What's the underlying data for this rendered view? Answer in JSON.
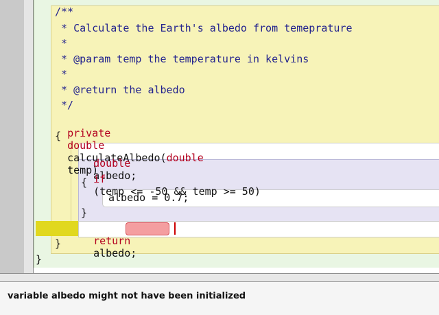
{
  "editor": {
    "comment_lines": [
      "/**",
      " * Calculate the Earth's albedo from temeprature",
      " *",
      " * @param temp the temperature in kelvins",
      " *",
      " * @return the albedo",
      " */"
    ],
    "method_signature": {
      "modifier": "private",
      "return_type": "double",
      "name": "calculateAlbedo(",
      "param_type": "double",
      "param_name": "temp)"
    },
    "open_brace": "{",
    "declaration": {
      "type": "double",
      "name": "albedo;"
    },
    "if_line": {
      "keyword": "if",
      "condition": "(temp <= -50 && temp >= 50)"
    },
    "if_open_brace": "{",
    "assignment": "albedo = 0.7;",
    "if_close_brace": "}",
    "return_line": {
      "keyword": "return",
      "variable": "albedo",
      "terminator": ";"
    },
    "method_close_brace": "}",
    "class_close_brace": "}"
  },
  "status": {
    "message": "variable albedo might not have been initialized"
  },
  "colors": {
    "comment": "#23238e",
    "keyword": "#b3001f",
    "error_highlight": "#f49ea0",
    "error_marker": "#e1d81f"
  }
}
